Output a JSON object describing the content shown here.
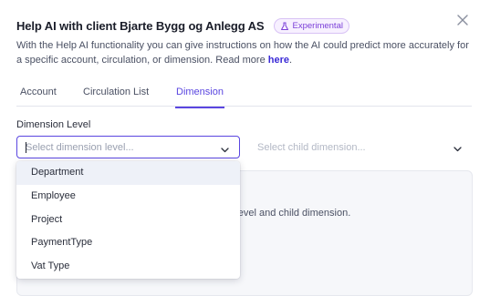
{
  "dialog": {
    "title": "Help AI with client Bjarte Bygg og Anlegg AS",
    "badge": "Experimental",
    "description": "With the Help AI functionality you can give instructions on how the AI could predict more accurately for a specific account, circulation, or dimension. Read more ",
    "read_more_link": "here",
    "description_end": "."
  },
  "tabs": [
    {
      "label": "Account"
    },
    {
      "label": "Circulation List"
    },
    {
      "label": "Dimension"
    }
  ],
  "active_tab": "Dimension",
  "form": {
    "dimension_level_label": "Dimension Level",
    "dimension_level_placeholder": "Select dimension level...",
    "child_dimension_placeholder": "Select child dimension..."
  },
  "dropdown": {
    "options": [
      {
        "label": "Department"
      },
      {
        "label": "Employee"
      },
      {
        "label": "Project"
      },
      {
        "label": "PaymentType"
      },
      {
        "label": "Vat Type"
      }
    ],
    "highlighted": "Department"
  },
  "panel": {
    "partial_text": "on level and child dimension."
  },
  "colors": {
    "accent": "#5a46e0",
    "badge_text": "#7b3fd8",
    "link": "#3b2bd6"
  },
  "icons": {
    "close": "close-icon",
    "badge": "flask-icon",
    "select_chevron": "chevron-down-icon"
  }
}
